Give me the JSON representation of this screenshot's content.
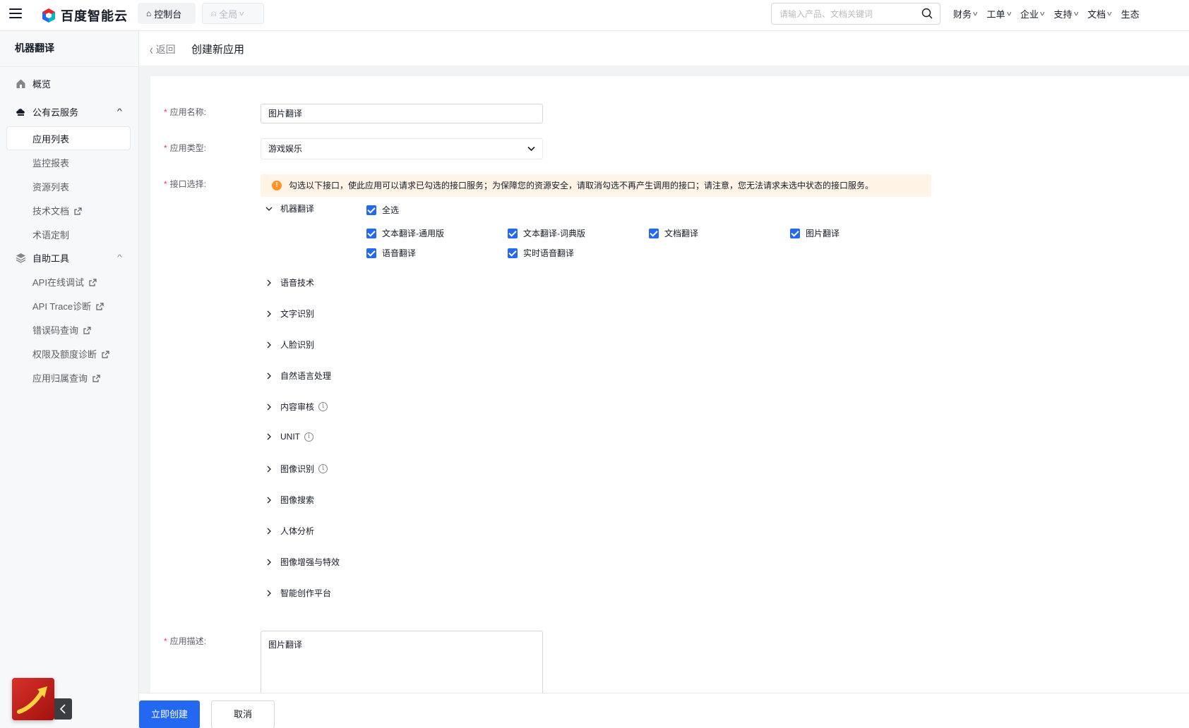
{
  "topbar": {
    "brand": "百度智能云",
    "console": "控制台",
    "scope": "全局",
    "search_placeholder": "请输入产品、文档关键词",
    "nav": [
      "财务",
      "工单",
      "企业",
      "支持",
      "文档",
      "生态"
    ]
  },
  "sidebar": {
    "title": "机器翻译",
    "overview": "概览",
    "public_cloud": "公有云服务",
    "public_items": [
      "应用列表",
      "监控报表",
      "资源列表",
      "技术文档",
      "术语定制"
    ],
    "tools": "自助工具",
    "tool_items": [
      "API在线调试",
      "API Trace诊断",
      "错误码查询",
      "权限及额度诊断",
      "应用归属查询"
    ]
  },
  "header": {
    "back": "返回",
    "title": "创建新应用"
  },
  "form": {
    "name_label": "应用名称:",
    "name_value": "图片翻译",
    "type_label": "应用类型:",
    "type_value": "游戏娱乐",
    "api_label": "接口选择:",
    "notice": "勾选以下接口，使此应用可以请求已勾选的接口服务；为保障您的资源安全，请取消勾选不再产生调用的接口；请注意，您无法请求未选中状态的接口服务。",
    "expanded_group": "机器翻译",
    "select_all": "全选",
    "mt_items": [
      "文本翻译-通用版",
      "文本翻译-词典版",
      "文档翻译",
      "图片翻译",
      "语音翻译",
      "实时语音翻译"
    ],
    "groups": [
      "语音技术",
      "文字识别",
      "人脸识别",
      "自然语言处理",
      "内容审核",
      "UNIT",
      "图像识别",
      "图像搜索",
      "人体分析",
      "图像增强与特效",
      "智能创作平台"
    ],
    "desc_label": "应用描述:",
    "desc_value": "图片翻译"
  },
  "footer": {
    "create": "立即创建",
    "cancel": "取消"
  },
  "colors": {
    "primary": "#2468f2",
    "warning": "#ff9326",
    "required": "#f33e3e"
  }
}
